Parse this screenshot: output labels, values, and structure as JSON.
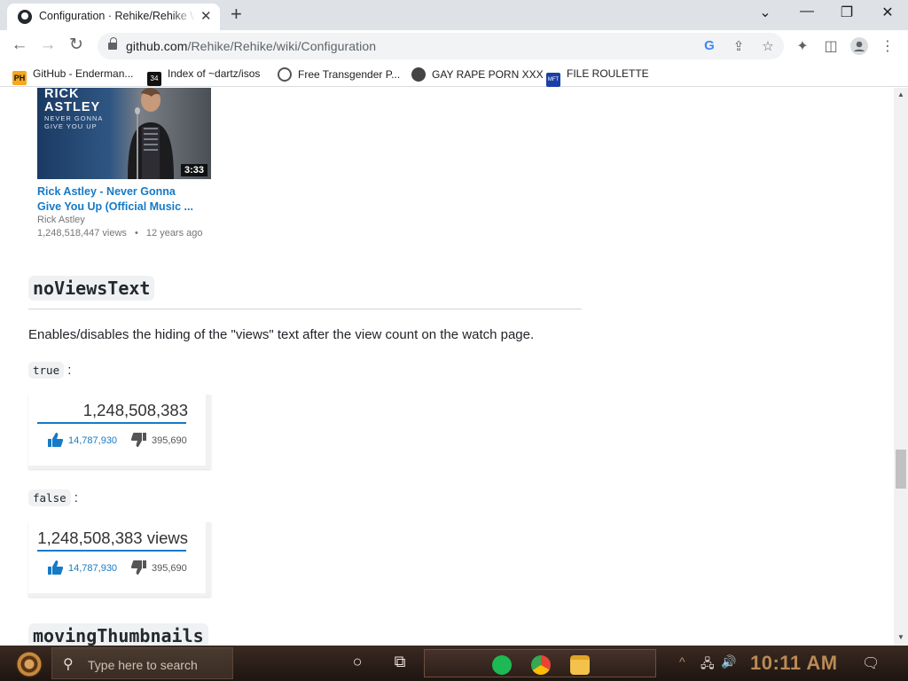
{
  "browser": {
    "tab_title": "Configuration · Rehike/Rehike Wiki",
    "url_host": "github.com",
    "url_path": "/Rehike/Rehike/wiki/Configuration",
    "bookmarks": [
      {
        "label": "GitHub - Enderman...",
        "icon": "ph-icon",
        "color": "#f7a81b"
      },
      {
        "label": "Index of ~dartz/isos",
        "icon": "folder-icon",
        "color": "#111111"
      },
      {
        "label": "Free Transgender P...",
        "icon": "pinwheel-icon",
        "color": "#555555"
      },
      {
        "label": "GAY RAPE PORN XXX",
        "icon": "globe-icon",
        "color": "#444444"
      },
      {
        "label": "FILE ROULETTE",
        "icon": "mft-icon",
        "color": "#1a3fa6"
      }
    ]
  },
  "video": {
    "thumb_line1": "RICK",
    "thumb_line2": "ASTLEY",
    "thumb_sub1": "NEVER GONNA",
    "thumb_sub2": "GIVE YOU UP",
    "duration": "3:33",
    "title_line1": "Rick Astley - Never Gonna",
    "title_line2": "Give You Up (Official Music  ...",
    "channel": "Rick Astley",
    "views": "1,248,518,447 views",
    "age": "12 years ago"
  },
  "section1": {
    "heading": "noViewsText",
    "description": "Enables/disables the hiding of the \"views\" text after the view count on the watch page.",
    "true_label": "true",
    "false_label": "false",
    "true_count": "1,248,508,383",
    "false_count": "1,248,508,383 views",
    "likes": "14,787,930",
    "dislikes": "395,690"
  },
  "section2": {
    "heading": "movingThumbnails"
  },
  "taskbar": {
    "search_placeholder": "Type here to search",
    "time": "10:11 AM"
  }
}
